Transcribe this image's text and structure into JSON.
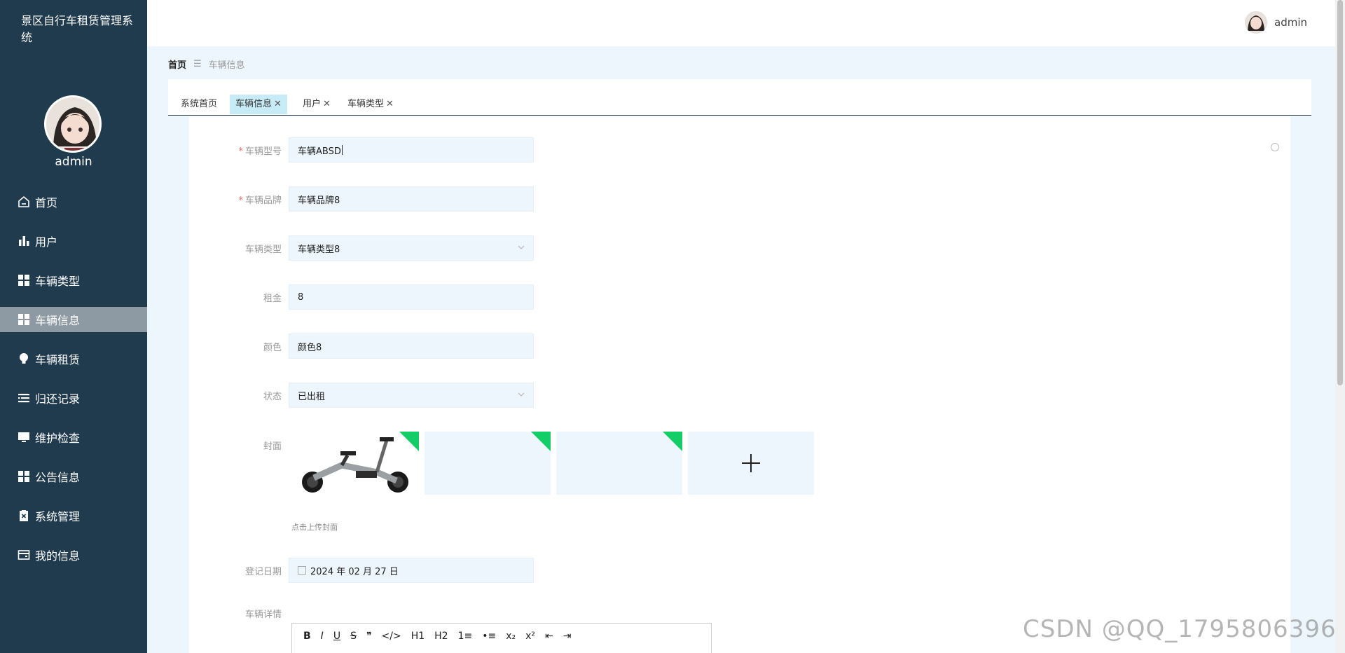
{
  "app": {
    "title": "景区自行车租赁管理系统",
    "user": "admin"
  },
  "sidebar": {
    "items": [
      {
        "label": "首页",
        "icon": "home-icon"
      },
      {
        "label": "用户",
        "icon": "bar-chart-icon"
      },
      {
        "label": "车辆类型",
        "icon": "grid-icon"
      },
      {
        "label": "车辆信息",
        "icon": "grid-icon",
        "active": true
      },
      {
        "label": "车辆租赁",
        "icon": "bulb-icon"
      },
      {
        "label": "归还记录",
        "icon": "list-icon"
      },
      {
        "label": "维护检查",
        "icon": "monitor-icon"
      },
      {
        "label": "公告信息",
        "icon": "grid-icon"
      },
      {
        "label": "系统管理",
        "icon": "clipboard-icon"
      },
      {
        "label": "我的信息",
        "icon": "card-icon"
      }
    ]
  },
  "breadcrumb": {
    "home": "首页",
    "sep": "☰",
    "current": "车辆信息"
  },
  "tabs": [
    {
      "label": "系统首页",
      "closable": false
    },
    {
      "label": "车辆信息",
      "closable": true,
      "active": true
    },
    {
      "label": "用户",
      "closable": true
    },
    {
      "label": "车辆类型",
      "closable": true
    }
  ],
  "form": {
    "model_label": "车辆型号",
    "model_value": "车辆ABSD",
    "brand_label": "车辆品牌",
    "brand_value": "车辆品牌8",
    "type_label": "车辆类型",
    "type_value": "车辆类型8",
    "rent_label": "租金",
    "rent_value": "8",
    "color_label": "颜色",
    "color_value": "颜色8",
    "status_label": "状态",
    "status_value": "已出租",
    "cover_label": "封面",
    "cover_hint": "点击上传封面",
    "date_label": "登记日期",
    "date_value": "2024 年 02 月 27 日",
    "detail_label": "车辆详情"
  },
  "editor_toolbar": [
    "B",
    "I",
    "U",
    "S",
    "❞",
    "</>",
    "H1",
    "H2",
    "1≡",
    "•≡",
    "x₂",
    "x²",
    "⇤",
    "⇥"
  ],
  "watermark": "CSDN @QQ_1795806396",
  "colors": {
    "sidebar": "#1f3b4d",
    "active_menu": "#8d9aa3",
    "active_tab": "#c8ecf7",
    "field_bg": "#eef6fd",
    "corner": "#13ce66"
  }
}
